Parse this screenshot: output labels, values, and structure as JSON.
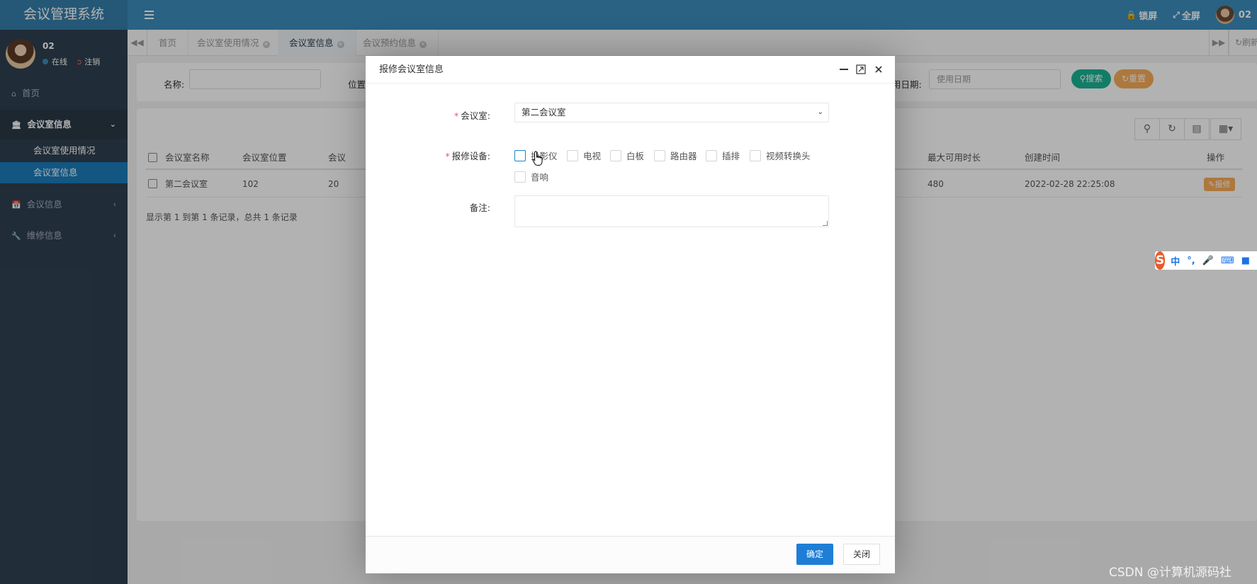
{
  "app": {
    "title": "会议管理系统"
  },
  "topbar": {
    "lock_label": "锁屏",
    "fullscreen_label": "全屏",
    "user_name": "02"
  },
  "sidebar": {
    "user_name": "02",
    "status_online": "在线",
    "status_logout": "注销",
    "items": [
      {
        "label": "首页"
      },
      {
        "label": "会议室信息"
      },
      {
        "label": "会议室使用情况"
      },
      {
        "label": "会议室信息"
      },
      {
        "label": "会议信息"
      },
      {
        "label": "维修信息"
      }
    ]
  },
  "tabs": [
    {
      "label": "首页"
    },
    {
      "label": "会议室使用情况"
    },
    {
      "label": "会议室信息"
    },
    {
      "label": "会议预约信息"
    }
  ],
  "tabs_refresh_label": "刷新",
  "search": {
    "name_label": "名称:",
    "location_label": "位置",
    "date_label": "用日期:",
    "date_placeholder": "使用日期",
    "search_button": "搜索",
    "reset_button": "重置"
  },
  "table": {
    "columns": [
      "会议室名称",
      "会议室位置",
      "会议",
      "最大可用时长",
      "创建时间",
      "操作"
    ],
    "rows": [
      {
        "name": "第二会议室",
        "location": "102",
        "capacity": "20",
        "max_duration": "480",
        "created": "2022-02-28 22:25:08",
        "action": "报修"
      }
    ],
    "pager_text": "显示第 1 到第 1 条记录，总共 1 条记录"
  },
  "modal": {
    "title": "报修会议室信息",
    "room_label": "会议室:",
    "room_value": "第二会议室",
    "equipment_label": "报修设备:",
    "equipment_options": [
      "投影仪",
      "电视",
      "白板",
      "路由器",
      "插排",
      "视频转换头",
      "音响"
    ],
    "remark_label": "备注:",
    "ok_button": "确定",
    "close_button": "关闭"
  },
  "ime": {
    "mode": "中",
    "punct": "°,",
    "logo": "S"
  },
  "watermark": "CSDN @计算机源码社",
  "colors": {
    "topbar": "#3c8dbc",
    "sidebar": "#2f4050",
    "active_nav": "#1a7bb9",
    "primary_button": "#1e7ed6",
    "search_button": "#1ab394",
    "reset_button": "#f8ac59"
  }
}
